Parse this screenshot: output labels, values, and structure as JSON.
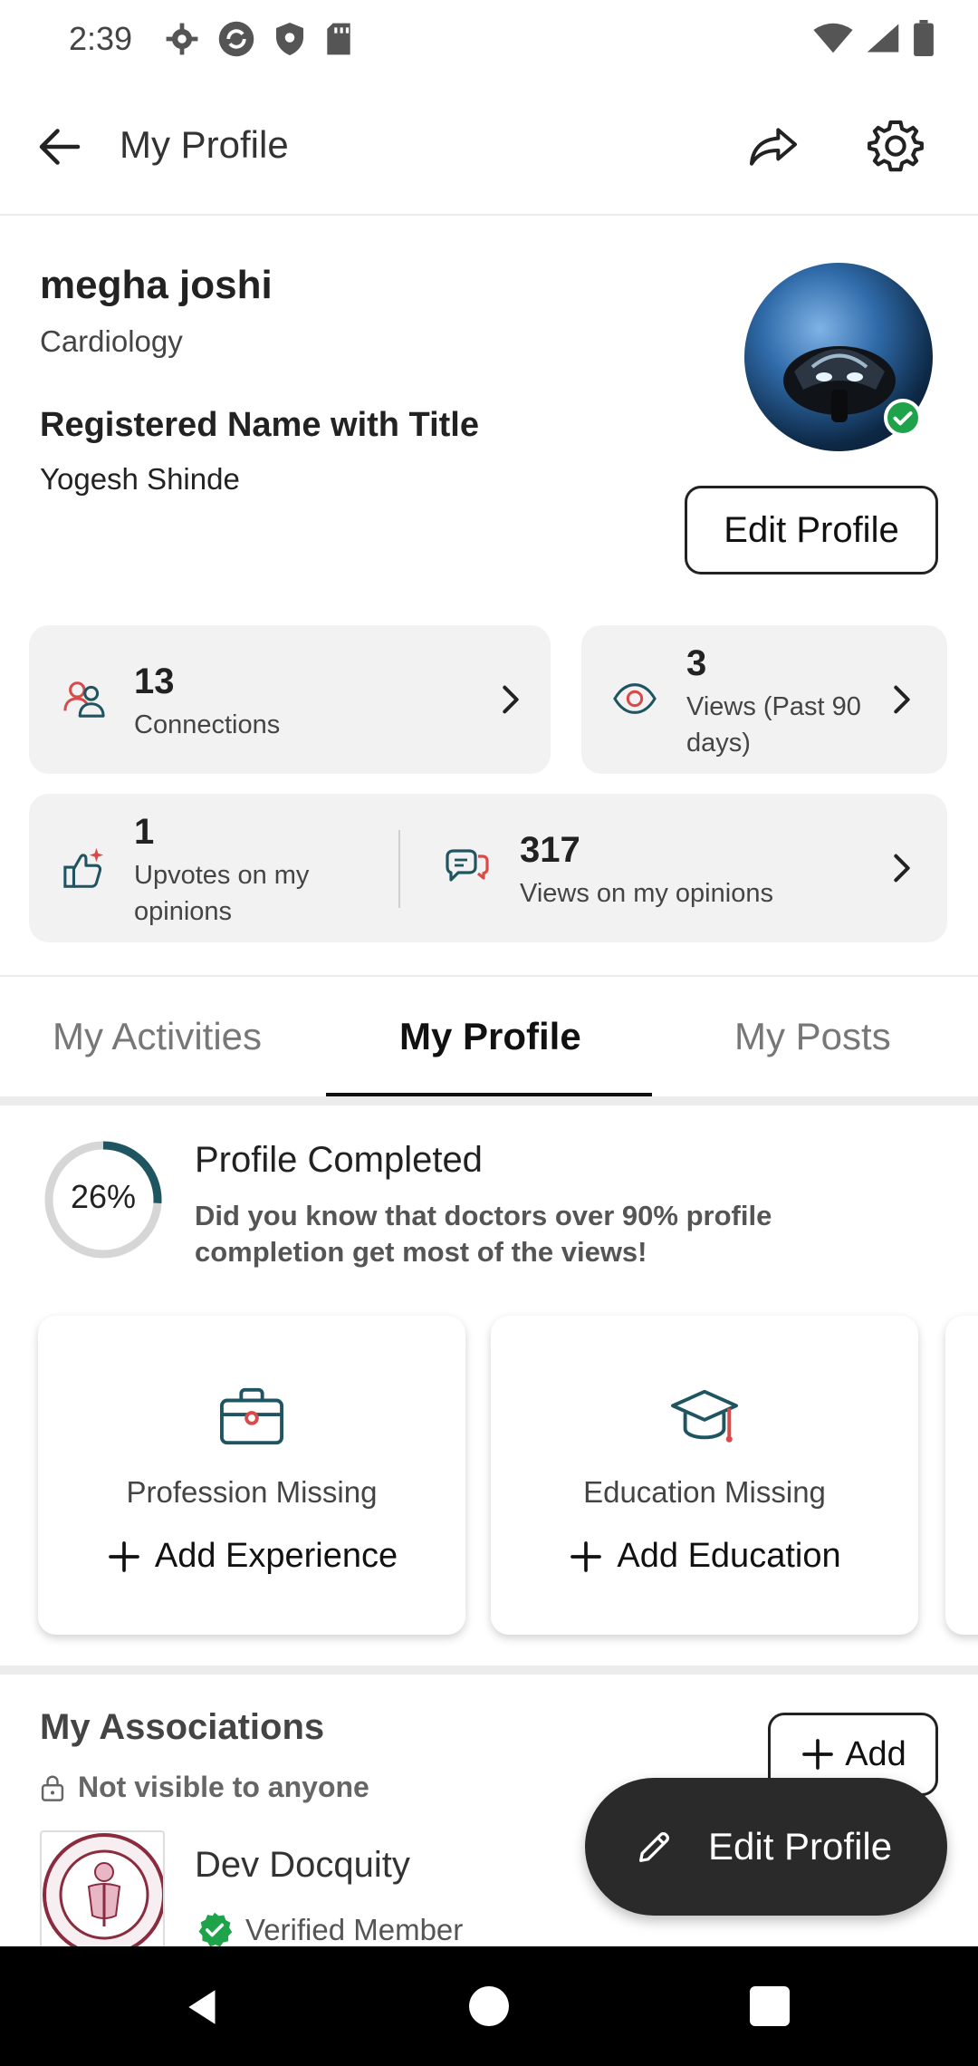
{
  "status_bar": {
    "time": "2:39"
  },
  "header": {
    "title": "My Profile"
  },
  "profile": {
    "name": "megha joshi",
    "specialty": "Cardiology",
    "registered_title_label": "Registered Name with Title",
    "registered_name": "Yogesh Shinde",
    "edit_button": "Edit Profile"
  },
  "stats": {
    "connections": {
      "value": "13",
      "label": "Connections"
    },
    "views": {
      "value": "3",
      "label_line1": "Views (Past 90",
      "label_line2": "days)"
    },
    "upvotes": {
      "value": "1",
      "label_line1": "Upvotes on my",
      "label_line2": "opinions"
    },
    "opinion_views": {
      "value": "317",
      "label": "Views on my opinions"
    }
  },
  "tabs": [
    {
      "label": "My Activities"
    },
    {
      "label": "My Profile"
    },
    {
      "label": "My Posts"
    }
  ],
  "completion": {
    "percent_text": "26%",
    "percent": 26,
    "title": "Profile Completed",
    "description": "Did you know that doctors over 90% profile completion get most of the views!"
  },
  "missing_cards": [
    {
      "label": "Profession Missing",
      "action": "Add Experience"
    },
    {
      "label": "Education Missing",
      "action": "Add Education"
    }
  ],
  "associations": {
    "title": "My Associations",
    "visibility": "Not visible to anyone",
    "add_button": "Add",
    "org_name": "Dev Docquity",
    "verified": "Verified Member"
  },
  "fab": {
    "label": "Edit Profile"
  },
  "colors": {
    "accent": "#1f5560",
    "verified_green": "#1fa34a",
    "icon_red": "#d94b4b"
  }
}
